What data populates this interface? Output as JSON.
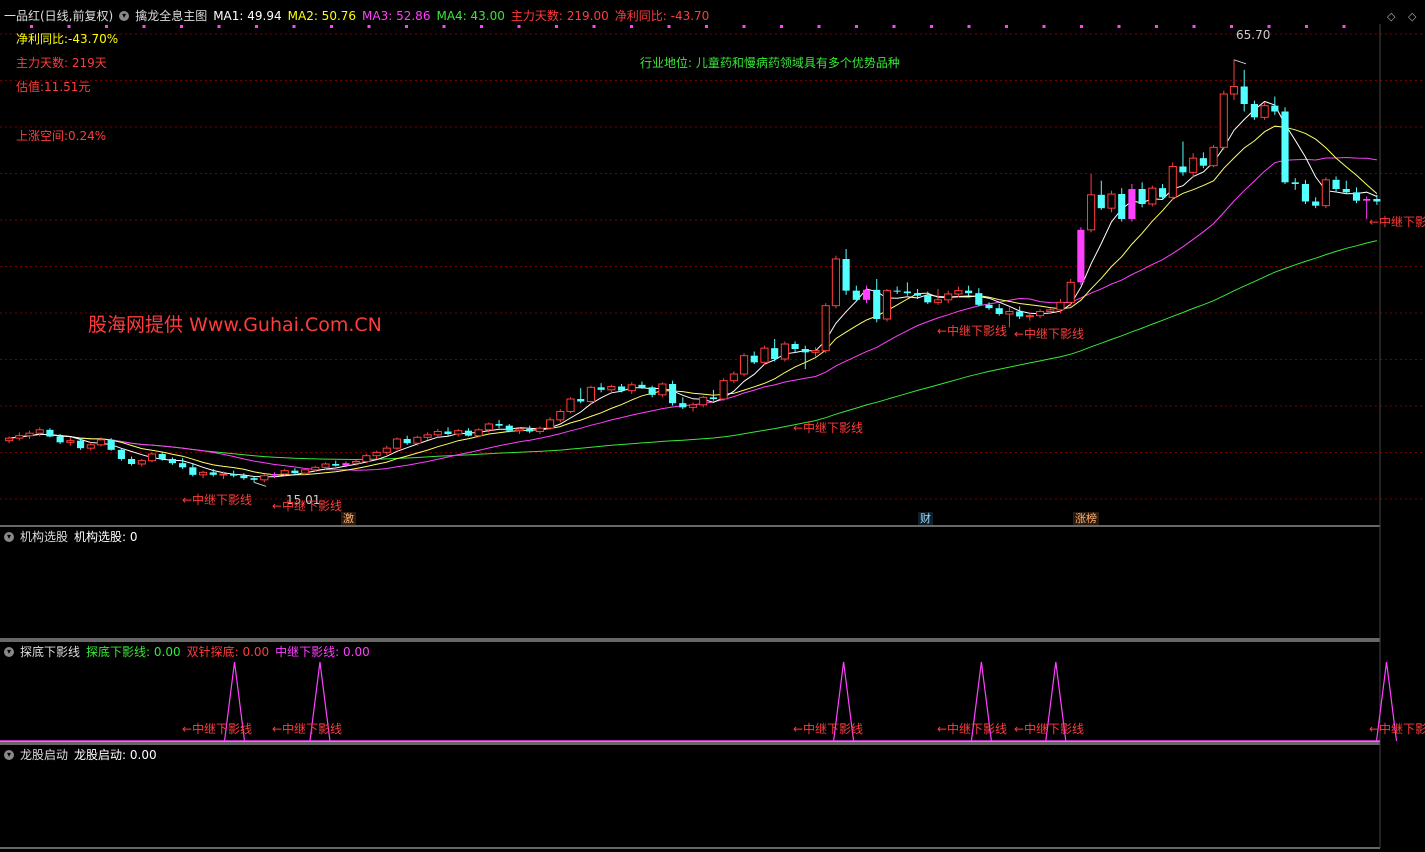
{
  "header": {
    "stock": "一品红(日线,前复权)",
    "indicator": "擒龙全息主图",
    "ma1": "MA1: 49.94",
    "ma2": "MA2: 50.76",
    "ma3": "MA3: 52.86",
    "ma4": "MA4: 43.00",
    "zhuli": "主力天数: 219.00",
    "jingli": "净利同比: -43.70"
  },
  "info": {
    "jingli": "净利同比:-43.70%",
    "zhuli": "主力天数: 219天",
    "guzhi": "估值:11.51元",
    "space": "上涨空间:0.24%",
    "industry": "行业地位: 儿童药和慢病药领域具有多个优势品种",
    "watermark": "股海网提供 Www.Guhai.Com.CN"
  },
  "labels": {
    "high": "65.70",
    "low": "15.01",
    "signal": "←中继下影线",
    "signal_cut": "←中继下影",
    "tag1": "激",
    "tag2": "财",
    "tag3": "涨榜"
  },
  "panels": {
    "p1_name": "机构选股",
    "p1_value": "机构选股: 0",
    "p2_name": "探底下影线",
    "p2_v1": "探底下影线: 0.00",
    "p2_v2": "双针探底: 0.00",
    "p2_v3": "中继下影线: 0.00",
    "p3_name": "龙股启动",
    "p3_value": "龙股启动: 0.00"
  },
  "colors": {
    "up": "#ff3c3c",
    "down": "#54ffff",
    "ma1": "#ffffff",
    "ma2": "#ffff66",
    "ma3": "#ff40ff",
    "ma4": "#38e838",
    "grid": "#7a0000",
    "signal": "#ff40ff"
  },
  "chart_data": {
    "type": "candlestick",
    "ylim": [
      10,
      70
    ],
    "high_marker": 65.7,
    "low_marker": 15.01,
    "candles": [
      [
        20.0,
        20.5,
        19.7,
        20.3
      ],
      [
        20.3,
        21.0,
        20.0,
        20.6
      ],
      [
        20.6,
        21.2,
        20.2,
        20.9
      ],
      [
        20.9,
        21.6,
        20.5,
        21.3
      ],
      [
        21.3,
        21.5,
        20.4,
        20.5
      ],
      [
        20.5,
        20.8,
        19.6,
        19.8
      ],
      [
        19.8,
        20.4,
        19.4,
        20.0
      ],
      [
        20.0,
        20.3,
        18.9,
        19.1
      ],
      [
        19.1,
        19.8,
        18.8,
        19.5
      ],
      [
        19.5,
        20.4,
        19.3,
        20.1
      ],
      [
        20.1,
        20.3,
        18.8,
        18.9
      ],
      [
        18.9,
        19.1,
        17.6,
        17.8
      ],
      [
        17.8,
        18.1,
        17.0,
        17.2
      ],
      [
        17.2,
        17.8,
        16.9,
        17.6
      ],
      [
        17.6,
        18.6,
        17.4,
        18.4
      ],
      [
        18.4,
        18.6,
        17.6,
        17.8
      ],
      [
        17.8,
        18.0,
        17.1,
        17.3
      ],
      [
        17.3,
        17.9,
        16.6,
        16.8
      ],
      [
        16.8,
        17.2,
        15.7,
        15.9
      ],
      [
        15.9,
        16.4,
        15.5,
        16.2
      ],
      [
        16.2,
        16.6,
        15.7,
        15.9
      ],
      [
        15.9,
        16.3,
        15.4,
        16.0
      ],
      [
        16.0,
        16.4,
        15.6,
        15.8
      ],
      [
        15.8,
        16.1,
        15.3,
        15.5
      ],
      [
        15.5,
        15.7,
        15.0,
        15.3
      ],
      [
        15.3,
        16.0,
        15.0,
        15.8
      ],
      [
        15.8,
        16.2,
        15.5,
        16.0
      ],
      [
        16.0,
        16.6,
        15.8,
        16.4
      ],
      [
        16.4,
        16.7,
        15.9,
        16.1
      ],
      [
        16.1,
        16.7,
        15.9,
        16.5
      ],
      [
        16.5,
        17.0,
        16.3,
        16.8
      ],
      [
        16.8,
        17.4,
        16.5,
        17.2
      ],
      [
        17.2,
        17.6,
        16.9,
        17.0
      ],
      [
        17.0,
        17.5,
        16.8,
        17.3
      ],
      [
        17.3,
        17.7,
        17.0,
        17.5
      ],
      [
        17.5,
        18.4,
        17.3,
        18.2
      ],
      [
        18.2,
        18.8,
        17.8,
        18.6
      ],
      [
        18.6,
        19.4,
        18.3,
        19.1
      ],
      [
        19.1,
        20.4,
        18.9,
        20.2
      ],
      [
        20.2,
        20.6,
        19.5,
        19.7
      ],
      [
        19.7,
        20.6,
        19.4,
        20.4
      ],
      [
        20.4,
        21.0,
        20.1,
        20.7
      ],
      [
        20.7,
        21.4,
        20.4,
        21.1
      ],
      [
        21.1,
        21.6,
        20.6,
        20.8
      ],
      [
        20.8,
        21.4,
        20.5,
        21.2
      ],
      [
        21.2,
        21.5,
        20.5,
        20.6
      ],
      [
        20.6,
        21.5,
        20.4,
        21.3
      ],
      [
        21.3,
        22.2,
        21.0,
        22.0
      ],
      [
        22.0,
        22.5,
        21.5,
        21.8
      ],
      [
        21.8,
        22.0,
        21.0,
        21.2
      ],
      [
        21.2,
        21.6,
        20.8,
        21.4
      ],
      [
        21.4,
        21.8,
        20.9,
        21.1
      ],
      [
        21.1,
        21.7,
        20.8,
        21.5
      ],
      [
        21.5,
        22.8,
        21.3,
        22.5
      ],
      [
        22.5,
        23.8,
        22.2,
        23.5
      ],
      [
        23.5,
        25.2,
        23.3,
        25.0
      ],
      [
        25.0,
        26.3,
        24.5,
        24.7
      ],
      [
        24.7,
        26.6,
        24.4,
        26.4
      ],
      [
        26.4,
        26.9,
        25.8,
        26.1
      ],
      [
        26.1,
        26.7,
        25.6,
        26.5
      ],
      [
        26.5,
        26.8,
        25.8,
        26.0
      ],
      [
        26.0,
        27.0,
        25.6,
        26.7
      ],
      [
        26.7,
        27.1,
        26.2,
        26.4
      ],
      [
        26.4,
        26.6,
        25.2,
        25.5
      ],
      [
        25.5,
        27.0,
        25.2,
        26.8
      ],
      [
        26.8,
        27.2,
        24.2,
        24.5
      ],
      [
        24.5,
        25.2,
        23.8,
        24.0
      ],
      [
        24.0,
        24.6,
        23.5,
        24.3
      ],
      [
        24.3,
        25.4,
        24.0,
        25.2
      ],
      [
        25.2,
        26.1,
        24.8,
        25.0
      ],
      [
        25.0,
        27.5,
        24.8,
        27.2
      ],
      [
        27.2,
        28.3,
        26.9,
        28.0
      ],
      [
        28.0,
        30.5,
        27.7,
        30.2
      ],
      [
        30.2,
        30.7,
        29.2,
        29.4
      ],
      [
        29.4,
        31.4,
        29.1,
        31.1
      ],
      [
        31.1,
        32.2,
        29.5,
        29.8
      ],
      [
        29.8,
        31.9,
        29.5,
        31.6
      ],
      [
        31.6,
        31.9,
        30.6,
        31.0
      ],
      [
        31.0,
        31.4,
        28.6,
        30.6
      ],
      [
        30.6,
        31.2,
        30.1,
        30.8
      ],
      [
        30.8,
        36.5,
        30.5,
        36.2
      ],
      [
        36.2,
        42.2,
        35.9,
        41.8
      ],
      [
        41.8,
        43.0,
        37.5,
        38.0
      ],
      [
        38.0,
        38.6,
        36.7,
        36.9
      ],
      [
        36.9,
        38.6,
        36.5,
        38.1
      ],
      [
        38.1,
        39.4,
        34.2,
        34.6
      ],
      [
        34.6,
        38.2,
        34.3,
        38.0
      ],
      [
        38.0,
        38.5,
        37.6,
        37.9
      ],
      [
        37.9,
        39.0,
        37.4,
        37.7
      ],
      [
        37.7,
        38.2,
        37.0,
        37.4
      ],
      [
        37.4,
        37.9,
        36.4,
        36.6
      ],
      [
        36.6,
        38.2,
        36.3,
        36.9
      ],
      [
        36.9,
        38.0,
        36.5,
        37.6
      ],
      [
        37.6,
        38.5,
        37.2,
        38.0
      ],
      [
        38.0,
        38.6,
        37.4,
        37.7
      ],
      [
        37.7,
        38.3,
        36.1,
        36.3
      ],
      [
        36.3,
        36.6,
        35.7,
        35.9
      ],
      [
        35.9,
        36.4,
        35.0,
        35.2
      ],
      [
        35.2,
        36.0,
        33.6,
        35.5
      ],
      [
        35.5,
        36.1,
        34.6,
        34.9
      ],
      [
        34.9,
        35.3,
        34.4,
        35.0
      ],
      [
        35.0,
        35.8,
        34.7,
        35.5
      ],
      [
        35.5,
        35.9,
        35.2,
        35.7
      ],
      [
        35.7,
        37.0,
        35.3,
        36.6
      ],
      [
        36.6,
        39.4,
        36.1,
        39.0
      ],
      [
        39.0,
        45.6,
        38.7,
        45.3
      ],
      [
        45.3,
        52.0,
        45.0,
        49.5
      ],
      [
        49.5,
        51.2,
        47.7,
        47.9
      ],
      [
        47.9,
        50.0,
        47.4,
        49.6
      ],
      [
        49.6,
        50.3,
        46.3,
        46.6
      ],
      [
        46.6,
        50.8,
        46.3,
        50.2
      ],
      [
        50.2,
        51.0,
        48.0,
        48.4
      ],
      [
        48.4,
        50.6,
        48.1,
        50.3
      ],
      [
        50.3,
        50.8,
        48.9,
        49.2
      ],
      [
        49.2,
        53.4,
        48.9,
        52.9
      ],
      [
        52.9,
        55.9,
        51.8,
        52.2
      ],
      [
        52.2,
        54.5,
        51.6,
        53.9
      ],
      [
        53.9,
        54.6,
        52.7,
        53.0
      ],
      [
        53.0,
        55.5,
        52.8,
        55.2
      ],
      [
        55.2,
        62.0,
        54.9,
        61.6
      ],
      [
        61.6,
        65.7,
        60.9,
        62.5
      ],
      [
        62.5,
        64.5,
        59.5,
        60.4
      ],
      [
        60.4,
        60.8,
        58.5,
        58.8
      ],
      [
        58.8,
        60.6,
        58.5,
        60.2
      ],
      [
        60.2,
        61.3,
        59.1,
        59.5
      ],
      [
        59.5,
        60.0,
        50.8,
        51.0
      ],
      [
        51.0,
        51.5,
        50.1,
        50.8
      ],
      [
        50.8,
        51.3,
        48.4,
        48.7
      ],
      [
        48.7,
        49.2,
        47.9,
        48.2
      ],
      [
        48.2,
        51.6,
        47.9,
        51.3
      ],
      [
        51.3,
        51.7,
        49.8,
        50.2
      ],
      [
        50.2,
        51.2,
        49.6,
        49.8
      ],
      [
        49.8,
        50.4,
        48.5,
        48.8
      ],
      [
        48.8,
        49.3,
        46.6,
        49.0
      ],
      [
        49.0,
        49.5,
        48.3,
        48.7
      ]
    ],
    "markers_index": [
      26,
      33,
      84,
      105,
      110,
      133
    ],
    "signal_pos": [
      0.131,
      0.193,
      0.573,
      0.673,
      0.727,
      0.967
    ]
  }
}
